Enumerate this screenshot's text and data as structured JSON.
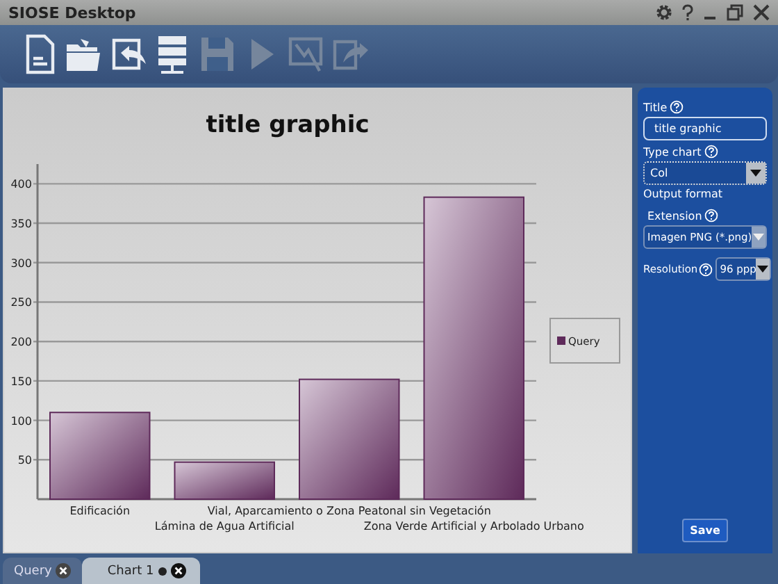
{
  "window": {
    "title": "SIOSE Desktop"
  },
  "toolbar": [
    {
      "kind": "new",
      "disabled": false
    },
    {
      "kind": "open",
      "disabled": false
    },
    {
      "kind": "import",
      "disabled": false
    },
    {
      "kind": "server",
      "disabled": false
    },
    {
      "kind": "save",
      "disabled": true
    },
    {
      "kind": "run",
      "disabled": true
    },
    {
      "kind": "chart",
      "disabled": true
    },
    {
      "kind": "export",
      "disabled": true
    }
  ],
  "chart": {
    "chart_data": {
      "type": "bar",
      "grid": true,
      "title": "title graphic",
      "categories": [
        "Edificación",
        "Lámina de Agua Artificial",
        "Vial, Aparcamiento o Zona Peatonal sin Vegetación",
        "Zona Verde Artificial y Arbolado Urbano"
      ],
      "ylim": [
        0,
        425
      ],
      "yticks": [
        50,
        100,
        150,
        200,
        250,
        300,
        350,
        400
      ],
      "series": [
        {
          "name": "Query",
          "color": "#5e2a5a",
          "values": [
            110,
            47,
            152,
            383
          ]
        }
      ]
    }
  },
  "panel": {
    "title_label": "Title",
    "title_value": "title graphic",
    "type_label": "Type chart",
    "type_value": "Col",
    "type_focused": true,
    "output_label": "Output format",
    "extension_label": "Extension",
    "extension_value": "Imagen PNG (*.png)",
    "extension_disabled": true,
    "resolution_label": "Resolution",
    "resolution_value": "96 ppp",
    "save": "Save"
  },
  "tabs": [
    {
      "label": "Query",
      "selected": false,
      "modified": false
    },
    {
      "label": "Chart 1",
      "selected": true,
      "modified": true
    }
  ]
}
